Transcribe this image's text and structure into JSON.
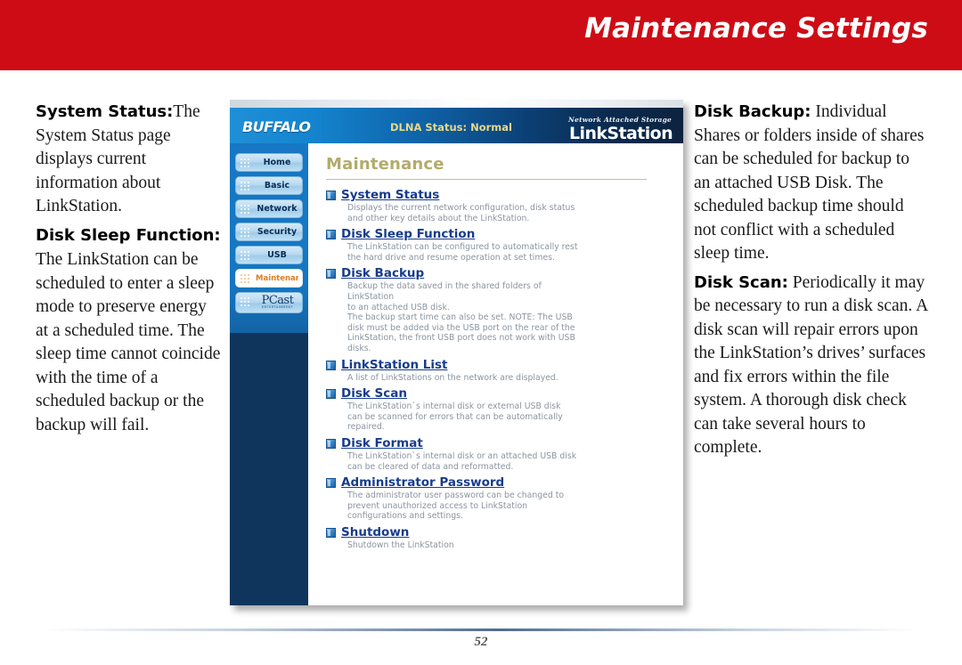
{
  "banner": {
    "title": "Maintenance Settings",
    "color": "#ce0c16"
  },
  "left_column": [
    {
      "lead": "System Status:",
      "inline": true,
      "body": "The System Status page displays current information about LinkStation."
    },
    {
      "lead": "Disk Sleep Function:",
      "inline": false,
      "body": "The LinkStation can be scheduled to enter a sleep mode to preserve energy at a scheduled time. The sleep time cannot coincide with the time of a scheduled backup or the backup will fail."
    }
  ],
  "right_column": [
    {
      "lead": "Disk Backup:",
      "inline": true,
      "body": " Individual Shares or folders inside of shares can be scheduled for backup to an attached USB Disk.  The scheduled backup time should not conflict with a scheduled sleep time."
    },
    {
      "lead": "Disk Scan:",
      "inline": true,
      "body": " Periodically it may be necessary to run a disk scan.  A disk scan will repair errors upon the LinkStation’s drives’ surfaces and fix errors within the file system.  A thorough disk check can take several hours to complete."
    }
  ],
  "screenshot": {
    "header": {
      "brand": "BUFFALO",
      "dlna_status": "DLNA Status: Normal",
      "nas_tagline": "Network Attached Storage",
      "product": "LinkStation"
    },
    "sidebar": {
      "items": [
        {
          "label": "Home",
          "active": false
        },
        {
          "label": "Basic",
          "active": false
        },
        {
          "label": "Network",
          "active": false
        },
        {
          "label": "Security",
          "active": false
        },
        {
          "label": "USB",
          "active": false
        },
        {
          "label": "Maintenance",
          "active": true
        }
      ],
      "pcast": {
        "label": "PCast",
        "sub": "ENTERTAINMENT"
      }
    },
    "main": {
      "heading": "Maintenance",
      "entries": [
        {
          "link": "System Status",
          "desc": [
            "Displays the current network configuration, disk status",
            "and other key details about the LinkStation."
          ]
        },
        {
          "link": "Disk Sleep Function",
          "desc": [
            "The LinkStation can be configured to automatically rest",
            "the hard drive and resume operation at set times."
          ]
        },
        {
          "link": "Disk Backup",
          "desc": [
            "Backup the data saved in the shared folders of",
            "LinkStation",
            "to an attached USB disk.",
            "The backup start time can also be set. NOTE: The USB",
            "disk must be added via the USB port on the rear of the",
            "LinkStation, the front USB port does not work with USB",
            "disks."
          ]
        },
        {
          "link": "LinkStation List",
          "desc": [
            "A list of LinkStations on the network are displayed."
          ]
        },
        {
          "link": "Disk Scan",
          "desc": [
            "The LinkStation`s internal disk or external USB disk",
            "can be scanned for errors that can be automatically",
            "repaired."
          ]
        },
        {
          "link": "Disk Format",
          "desc": [
            "The LinkStation`s internal disk or an attached USB disk",
            "can be cleared of data and reformatted."
          ]
        },
        {
          "link": "Administrator Password",
          "desc": [
            "The administrator user password can be changed to",
            "prevent unauthorized access to LinkStation",
            "configurations and settings."
          ]
        },
        {
          "link": "Shutdown",
          "desc": [
            "Shutdown the LinkStation"
          ]
        }
      ]
    }
  },
  "footer": {
    "page_number": "52"
  }
}
